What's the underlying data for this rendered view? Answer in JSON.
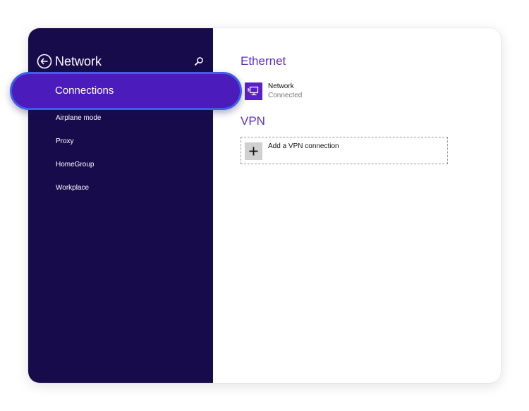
{
  "sidebar": {
    "title": "Network",
    "back_icon": "back-arrow-circle-icon",
    "search_icon": "search-icon",
    "selected_item": "Connections",
    "items": [
      {
        "label": "Connections",
        "selected": true
      },
      {
        "label": "Airplane mode",
        "selected": false
      },
      {
        "label": "Proxy",
        "selected": false
      },
      {
        "label": "HomeGroup",
        "selected": false
      },
      {
        "label": "Workplace",
        "selected": false
      }
    ]
  },
  "content": {
    "ethernet_heading": "Ethernet",
    "network": {
      "name": "Network",
      "status": "Connected",
      "icon": "ethernet-network-icon"
    },
    "vpn_heading": "VPN",
    "vpn_add": {
      "label": "Add a VPN connection",
      "icon": "plus-icon"
    }
  },
  "colors": {
    "sidebar_bg": "#180b4c",
    "accent": "#5b2fc9",
    "selected_pill": "#4b1bbc",
    "selected_pill_border": "#3d5fe8",
    "tile_bg": "#d0d0d0"
  }
}
